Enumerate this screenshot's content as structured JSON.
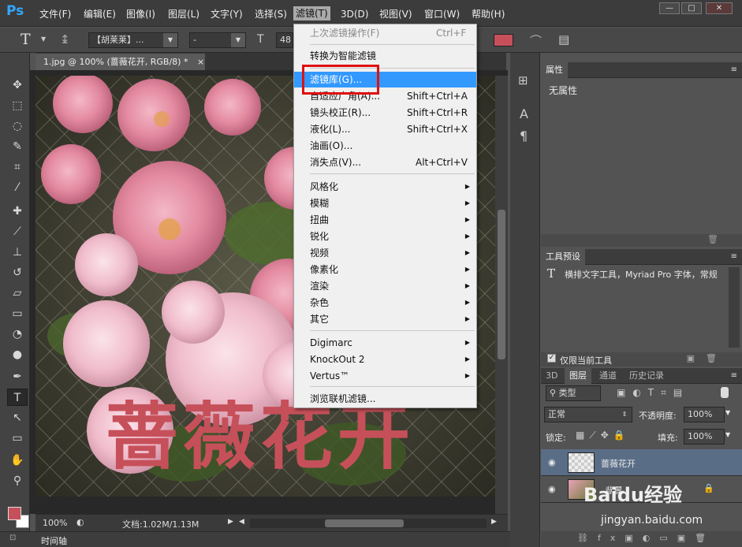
{
  "app": {
    "logo": "Ps"
  },
  "menu": [
    "文件(F)",
    "编辑(E)",
    "图像(I)",
    "图层(L)",
    "文字(Y)",
    "选择(S)",
    "滤镜(T)",
    "3D(D)",
    "视图(V)",
    "窗口(W)",
    "帮助(H)"
  ],
  "window_buttons": [
    "—",
    "□",
    "✕"
  ],
  "options": {
    "tool_glyph": "T",
    "font_family": "【胡莱莱】...",
    "font_style": "-",
    "font_size": "48",
    "color_hex": "#c6505a"
  },
  "document": {
    "tab_title": "1.jpg @ 100% (蔷薇花开, RGB/8) *",
    "close": "×",
    "overlay_text": "蔷薇花开",
    "overlay_color": "#c6505a",
    "zoom": "100%",
    "doc_size": "文档:1.02M/1.13M"
  },
  "timeline": {
    "label": "时间轴"
  },
  "filter_menu": {
    "items": [
      {
        "label": "上次滤镜操作(F)",
        "shortcut": "Ctrl+F",
        "disabled": true
      },
      {
        "label": "转换为智能滤镜",
        "shortcut": ""
      },
      {
        "label": "滤镜库(G)...",
        "shortcut": "",
        "highlighted": true
      },
      {
        "label": "自适应广角(A)...",
        "shortcut": "Shift+Ctrl+A"
      },
      {
        "label": "镜头校正(R)...",
        "shortcut": "Shift+Ctrl+R"
      },
      {
        "label": "液化(L)...",
        "shortcut": "Shift+Ctrl+X"
      },
      {
        "label": "油画(O)...",
        "shortcut": ""
      },
      {
        "label": "消失点(V)...",
        "shortcut": "Alt+Ctrl+V"
      },
      {
        "label": "风格化",
        "submenu": true
      },
      {
        "label": "模糊",
        "submenu": true
      },
      {
        "label": "扭曲",
        "submenu": true
      },
      {
        "label": "锐化",
        "submenu": true
      },
      {
        "label": "视频",
        "submenu": true
      },
      {
        "label": "像素化",
        "submenu": true
      },
      {
        "label": "渲染",
        "submenu": true
      },
      {
        "label": "杂色",
        "submenu": true
      },
      {
        "label": "其它",
        "submenu": true
      },
      {
        "label": "Digimarc",
        "submenu": true
      },
      {
        "label": "KnockOut 2",
        "submenu": true
      },
      {
        "label": "Vertus™",
        "submenu": true
      },
      {
        "label": "浏览联机滤镜...",
        "shortcut": ""
      }
    ]
  },
  "properties": {
    "title": "属性",
    "body": "无属性"
  },
  "tool_presets": {
    "title": "工具预设",
    "entry": "横排文字工具，Myriad Pro 字体，常规",
    "checkbox": "仅限当前工具"
  },
  "layers_panel": {
    "tabs": [
      "3D",
      "图层",
      "通道",
      "历史记录"
    ],
    "filter_kind": "类型",
    "blend_mode": "正常",
    "opacity_label": "不透明度:",
    "opacity_value": "100%",
    "lock_label": "锁定:",
    "fill_label": "填充:",
    "fill_value": "100%",
    "layers": [
      {
        "name": "蔷薇花开",
        "selected": true
      },
      {
        "name": "背景",
        "locked": true
      }
    ]
  },
  "watermark": {
    "text": "Baidu经验",
    "url": "jingyan.baidu.com"
  },
  "colors": {
    "foreground": "#c6505a",
    "background": "#ffffff",
    "highlight": "#3399ff",
    "red_box": "#e01010"
  }
}
